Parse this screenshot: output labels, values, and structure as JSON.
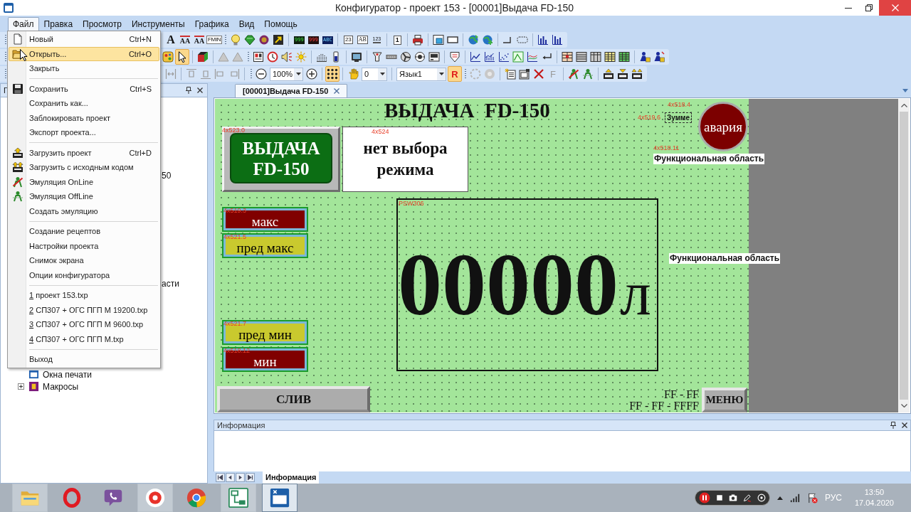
{
  "window": {
    "title": "Конфигуратор - проект 153 - [00001]Выдача FD-150"
  },
  "menu_bar": [
    {
      "label": "Файл",
      "selected": true
    },
    {
      "label": "Правка",
      "selected": false
    },
    {
      "label": "Просмотр",
      "selected": false
    },
    {
      "label": "Инструменты",
      "selected": false
    },
    {
      "label": "Графика",
      "selected": false
    },
    {
      "label": "Вид",
      "selected": false
    },
    {
      "label": "Помощь",
      "selected": false
    }
  ],
  "toolbars": [
    {
      "items": [
        {
          "kind": "glyph",
          "text": "A",
          "pressed": false
        },
        {
          "kind": "glyph",
          "text": "AA",
          "pressed": false
        },
        {
          "kind": "glyph",
          "text": "AA",
          "pressed": false
        },
        {
          "kind": "glyph",
          "text": "FMIN",
          "pressed": false
        },
        {
          "kind": "grip"
        },
        {
          "kind": "icon",
          "pressed": false
        },
        {
          "kind": "icon",
          "pressed": false
        },
        {
          "kind": "icon",
          "pressed": false
        },
        {
          "kind": "icon",
          "pressed": false
        },
        {
          "kind": "separator"
        },
        {
          "kind": "glyph",
          "text": "999",
          "pressed": false
        },
        {
          "kind": "glyph",
          "text": "999",
          "pressed": false
        },
        {
          "kind": "glyph",
          "text": "ABC",
          "pressed": false
        },
        {
          "kind": "separator"
        },
        {
          "kind": "glyph",
          "text": "23",
          "pressed": false
        },
        {
          "kind": "glyph",
          "text": "AB",
          "pressed": false
        },
        {
          "kind": "glyph",
          "text": "123",
          "pressed": false
        },
        {
          "kind": "separator"
        },
        {
          "kind": "glyph",
          "text": "1",
          "pressed": false
        },
        {
          "kind": "separator"
        },
        {
          "kind": "icon",
          "pressed": false
        },
        {
          "kind": "separator"
        },
        {
          "kind": "icon",
          "pressed": false
        },
        {
          "kind": "icon",
          "pressed": false
        },
        {
          "kind": "separator"
        },
        {
          "kind": "icon",
          "pressed": false
        },
        {
          "kind": "icon",
          "pressed": false
        },
        {
          "kind": "separator"
        },
        {
          "kind": "icon",
          "pressed": false
        },
        {
          "kind": "icon",
          "pressed": false
        },
        {
          "kind": "separator"
        },
        {
          "kind": "icon",
          "pressed": false
        },
        {
          "kind": "icon",
          "pressed": false
        }
      ]
    },
    {
      "items": [
        {
          "kind": "icon",
          "pressed": false
        },
        {
          "kind": "icon",
          "pressed": true
        },
        {
          "kind": "separator"
        },
        {
          "kind": "icon",
          "pressed": false
        },
        {
          "kind": "separator"
        },
        {
          "kind": "icon",
          "pressed": false
        },
        {
          "kind": "icon",
          "pressed": false
        },
        {
          "kind": "grip"
        },
        {
          "kind": "icon",
          "pressed": false
        },
        {
          "kind": "icon",
          "pressed": false
        },
        {
          "kind": "icon",
          "pressed": false
        },
        {
          "kind": "icon",
          "pressed": false
        },
        {
          "kind": "separator"
        },
        {
          "kind": "icon",
          "pressed": false
        },
        {
          "kind": "icon",
          "pressed": false
        },
        {
          "kind": "separator"
        },
        {
          "kind": "icon",
          "pressed": false
        },
        {
          "kind": "separator"
        },
        {
          "kind": "icon",
          "pressed": false
        },
        {
          "kind": "icon",
          "pressed": false
        },
        {
          "kind": "icon",
          "pressed": false
        },
        {
          "kind": "icon",
          "pressed": false
        },
        {
          "kind": "icon",
          "pressed": false
        },
        {
          "kind": "separator"
        },
        {
          "kind": "icon",
          "pressed": false
        },
        {
          "kind": "separator"
        },
        {
          "kind": "icon",
          "pressed": false
        },
        {
          "kind": "icon",
          "pressed": false
        },
        {
          "kind": "icon",
          "pressed": false
        },
        {
          "kind": "icon",
          "pressed": false
        },
        {
          "kind": "icon",
          "pressed": false
        },
        {
          "kind": "icon",
          "pressed": false
        },
        {
          "kind": "separator"
        },
        {
          "kind": "icon",
          "pressed": false
        },
        {
          "kind": "icon",
          "pressed": false
        },
        {
          "kind": "icon",
          "pressed": false
        },
        {
          "kind": "icon",
          "pressed": false
        },
        {
          "kind": "icon",
          "pressed": false
        },
        {
          "kind": "separator"
        },
        {
          "kind": "icon",
          "pressed": false
        },
        {
          "kind": "icon",
          "pressed": false
        }
      ]
    },
    {
      "items": [
        {
          "kind": "icon",
          "pressed": false
        },
        {
          "kind": "separator"
        },
        {
          "kind": "icon",
          "pressed": false
        },
        {
          "kind": "icon",
          "pressed": false
        },
        {
          "kind": "icon",
          "pressed": false
        },
        {
          "kind": "icon",
          "pressed": false
        },
        {
          "kind": "separator"
        },
        {
          "kind": "grip"
        },
        {
          "kind": "icon",
          "pressed": false
        },
        {
          "kind": "dropdown",
          "value": "100%"
        },
        {
          "kind": "icon",
          "pressed": false
        },
        {
          "kind": "separator"
        },
        {
          "kind": "icon",
          "pressed": true
        },
        {
          "kind": "separator"
        },
        {
          "kind": "icon",
          "pressed": false
        },
        {
          "kind": "dropdown",
          "value": "0"
        },
        {
          "kind": "separator"
        },
        {
          "kind": "dropdown",
          "value": "Язык1"
        },
        {
          "kind": "glyph",
          "text": "R",
          "pressed": true
        },
        {
          "kind": "grip"
        },
        {
          "kind": "icon",
          "pressed": false
        },
        {
          "kind": "icon",
          "pressed": false
        },
        {
          "kind": "separator"
        },
        {
          "kind": "icon",
          "pressed": false
        },
        {
          "kind": "icon",
          "pressed": false
        },
        {
          "kind": "icon",
          "pressed": false
        },
        {
          "kind": "glyph",
          "text": "F",
          "pressed": false
        },
        {
          "kind": "separator"
        },
        {
          "kind": "icon",
          "pressed": false
        },
        {
          "kind": "icon",
          "pressed": false
        },
        {
          "kind": "separator"
        },
        {
          "kind": "icon",
          "pressed": false
        },
        {
          "kind": "icon",
          "pressed": false
        },
        {
          "kind": "icon",
          "pressed": false
        }
      ]
    }
  ],
  "file_menu": {
    "groups": [
      [
        {
          "kind": "command",
          "label": "Новый",
          "shortcut": "Ctrl+N",
          "selected": false
        },
        {
          "kind": "command",
          "label": "Открыть...",
          "shortcut": "Ctrl+O",
          "selected": true
        },
        {
          "kind": "command",
          "label": "Закрыть",
          "selected": false
        }
      ],
      [
        {
          "kind": "command",
          "label": "Сохранить",
          "shortcut": "Ctrl+S",
          "selected": false
        },
        {
          "kind": "command",
          "label": "Сохранить как...",
          "selected": false
        },
        {
          "kind": "command",
          "label": "Заблокировать проект",
          "selected": false
        },
        {
          "kind": "command",
          "label": "Экспорт проекта...",
          "selected": false
        }
      ],
      [
        {
          "kind": "command",
          "label": "Загрузить проект",
          "shortcut": "Ctrl+D",
          "selected": false
        },
        {
          "kind": "command",
          "label": "Загрузить с исходным кодом",
          "selected": false
        },
        {
          "kind": "command",
          "label": "Эмуляция OnLine",
          "selected": false
        },
        {
          "kind": "command",
          "label": "Эмуляция OffLine",
          "selected": false
        },
        {
          "kind": "command",
          "label": "Создать эмуляцию",
          "selected": false
        }
      ],
      [
        {
          "kind": "command",
          "label": "Создание рецептов",
          "selected": false
        },
        {
          "kind": "command",
          "label": "Настройки проекта",
          "selected": false
        },
        {
          "kind": "command",
          "label": "Снимок экрана",
          "selected": false
        },
        {
          "kind": "command",
          "label": "Опции конфигуратора",
          "selected": false
        }
      ],
      [
        {
          "kind": "recent",
          "label": "1 проект 153.txp",
          "selected": false
        },
        {
          "kind": "recent",
          "label": "2 СП307 + ОГС ПГП М 19200.txp",
          "selected": false
        },
        {
          "kind": "recent",
          "label": "3 СП307 + ОГС ПГП М 9600.txp",
          "selected": false
        },
        {
          "kind": "recent",
          "label": "4 СП307 + ОГС ПГП М.txp",
          "selected": false
        }
      ],
      [
        {
          "kind": "command",
          "label": "Выход",
          "selected": false
        }
      ]
    ]
  },
  "project_panel": {
    "title": "Г",
    "tree": [
      {
        "kind": "fragment",
        "label": "50"
      },
      {
        "kind": "fragment",
        "label": "асти"
      },
      {
        "kind": "leaf",
        "label": "Окна печати"
      },
      {
        "kind": "folder",
        "label": "Макросы",
        "expanded": false
      }
    ]
  },
  "document_tabs": [
    {
      "label": "[00001]Выдача FD-150",
      "selected": true
    }
  ],
  "screen_canvas": {
    "title": "ВЫДАЧА  FD-150",
    "main_button": {
      "tag": "4x523.0",
      "label": "ВЫДАЧА FD-150"
    },
    "mode_display": {
      "tag": "4x524",
      "text": "нет выбора режима"
    },
    "level_lamps": [
      {
        "tag": "4x519.3",
        "label": "макс",
        "color": "#800000"
      },
      {
        "tag": "4x521.5",
        "label": "пред макс",
        "color": "#c9c92e"
      },
      {
        "tag": "4x521.7",
        "label": "пред мин",
        "color": "#c9c92e"
      },
      {
        "tag": "4x518.12",
        "label": "мин",
        "color": "#800000"
      }
    ],
    "counter": {
      "tag": "PSW306",
      "value": "00000",
      "unit": "л"
    },
    "alarm_lamp": {
      "tag": "4x518.4",
      "label": "авария"
    },
    "buzzer": {
      "tag": "4x519.6",
      "label": "Зумме"
    },
    "function_areas": [
      {
        "tag": "4x518.11",
        "label": "Функциональная область"
      },
      {
        "label": "Функциональная область"
      }
    ],
    "buttons": [
      {
        "label": "СЛИВ"
      },
      {
        "label": "МЕНЮ"
      }
    ],
    "datetime_labels": [
      "FF - FF",
      "FF - FF - FFFF"
    ]
  },
  "info_panel": {
    "title": "Информация",
    "tabs": [
      {
        "label": "Информация",
        "selected": true
      }
    ]
  },
  "taskbar": {
    "apps": [
      {
        "open": true,
        "selected": false
      },
      {
        "open": false,
        "selected": false
      },
      {
        "open": false,
        "selected": false
      },
      {
        "open": true,
        "selected": false
      },
      {
        "open": false,
        "selected": false
      },
      {
        "open": true,
        "selected": false
      },
      {
        "open": true,
        "selected": true
      }
    ],
    "tray": {
      "language": "РУС",
      "time": "13:50",
      "date": "17.04.2020"
    }
  }
}
